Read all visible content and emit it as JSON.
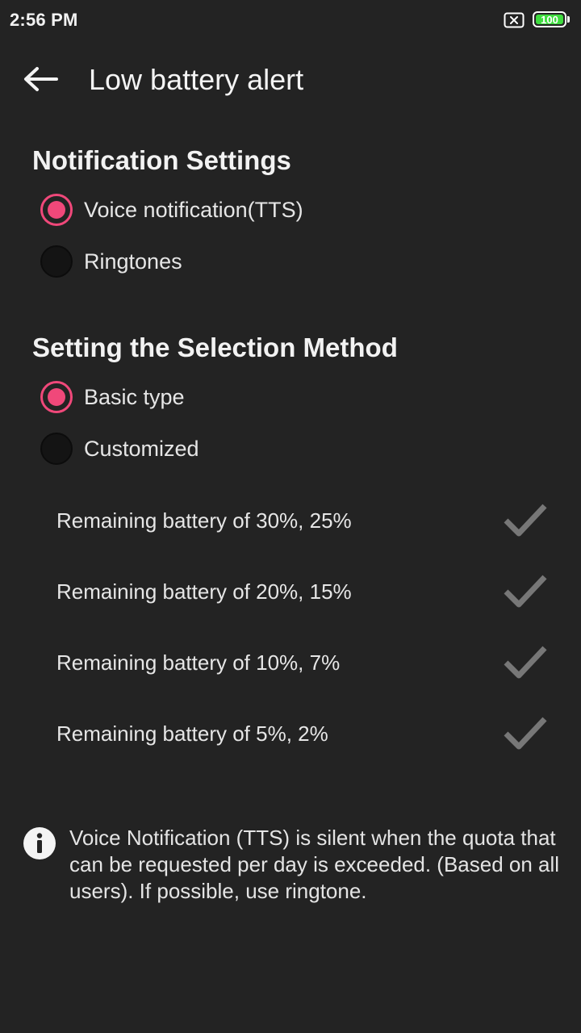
{
  "status_bar": {
    "time": "2:56 PM",
    "sim_icon": "sim-error-icon",
    "battery_level": "100",
    "battery_color": "#3fdc3f"
  },
  "toolbar": {
    "back_icon": "arrow-left-icon",
    "title": "Low battery alert"
  },
  "notification_settings": {
    "title": "Notification Settings",
    "options": [
      {
        "label": "Voice notification(TTS)",
        "checked": true
      },
      {
        "label": "Ringtones",
        "checked": false
      }
    ]
  },
  "selection_method": {
    "title": "Setting the Selection Method",
    "options": [
      {
        "label": "Basic type",
        "checked": true
      },
      {
        "label": "Customized",
        "checked": false
      }
    ]
  },
  "thresholds": [
    {
      "label": "Remaining battery of 30%, 25%",
      "checked": true
    },
    {
      "label": "Remaining battery of 20%, 15%",
      "checked": true
    },
    {
      "label": "Remaining battery of 10%, 7%",
      "checked": true
    },
    {
      "label": "Remaining battery of 5%, 2%",
      "checked": true
    }
  ],
  "info": {
    "icon": "info-icon",
    "text": "Voice Notification (TTS) is silent when the quota that can be requested per day is exceeded. (Based on all users). If possible, use ringtone."
  },
  "colors": {
    "background": "#232323",
    "accent": "#f0487a",
    "check_disabled": "#777777"
  }
}
